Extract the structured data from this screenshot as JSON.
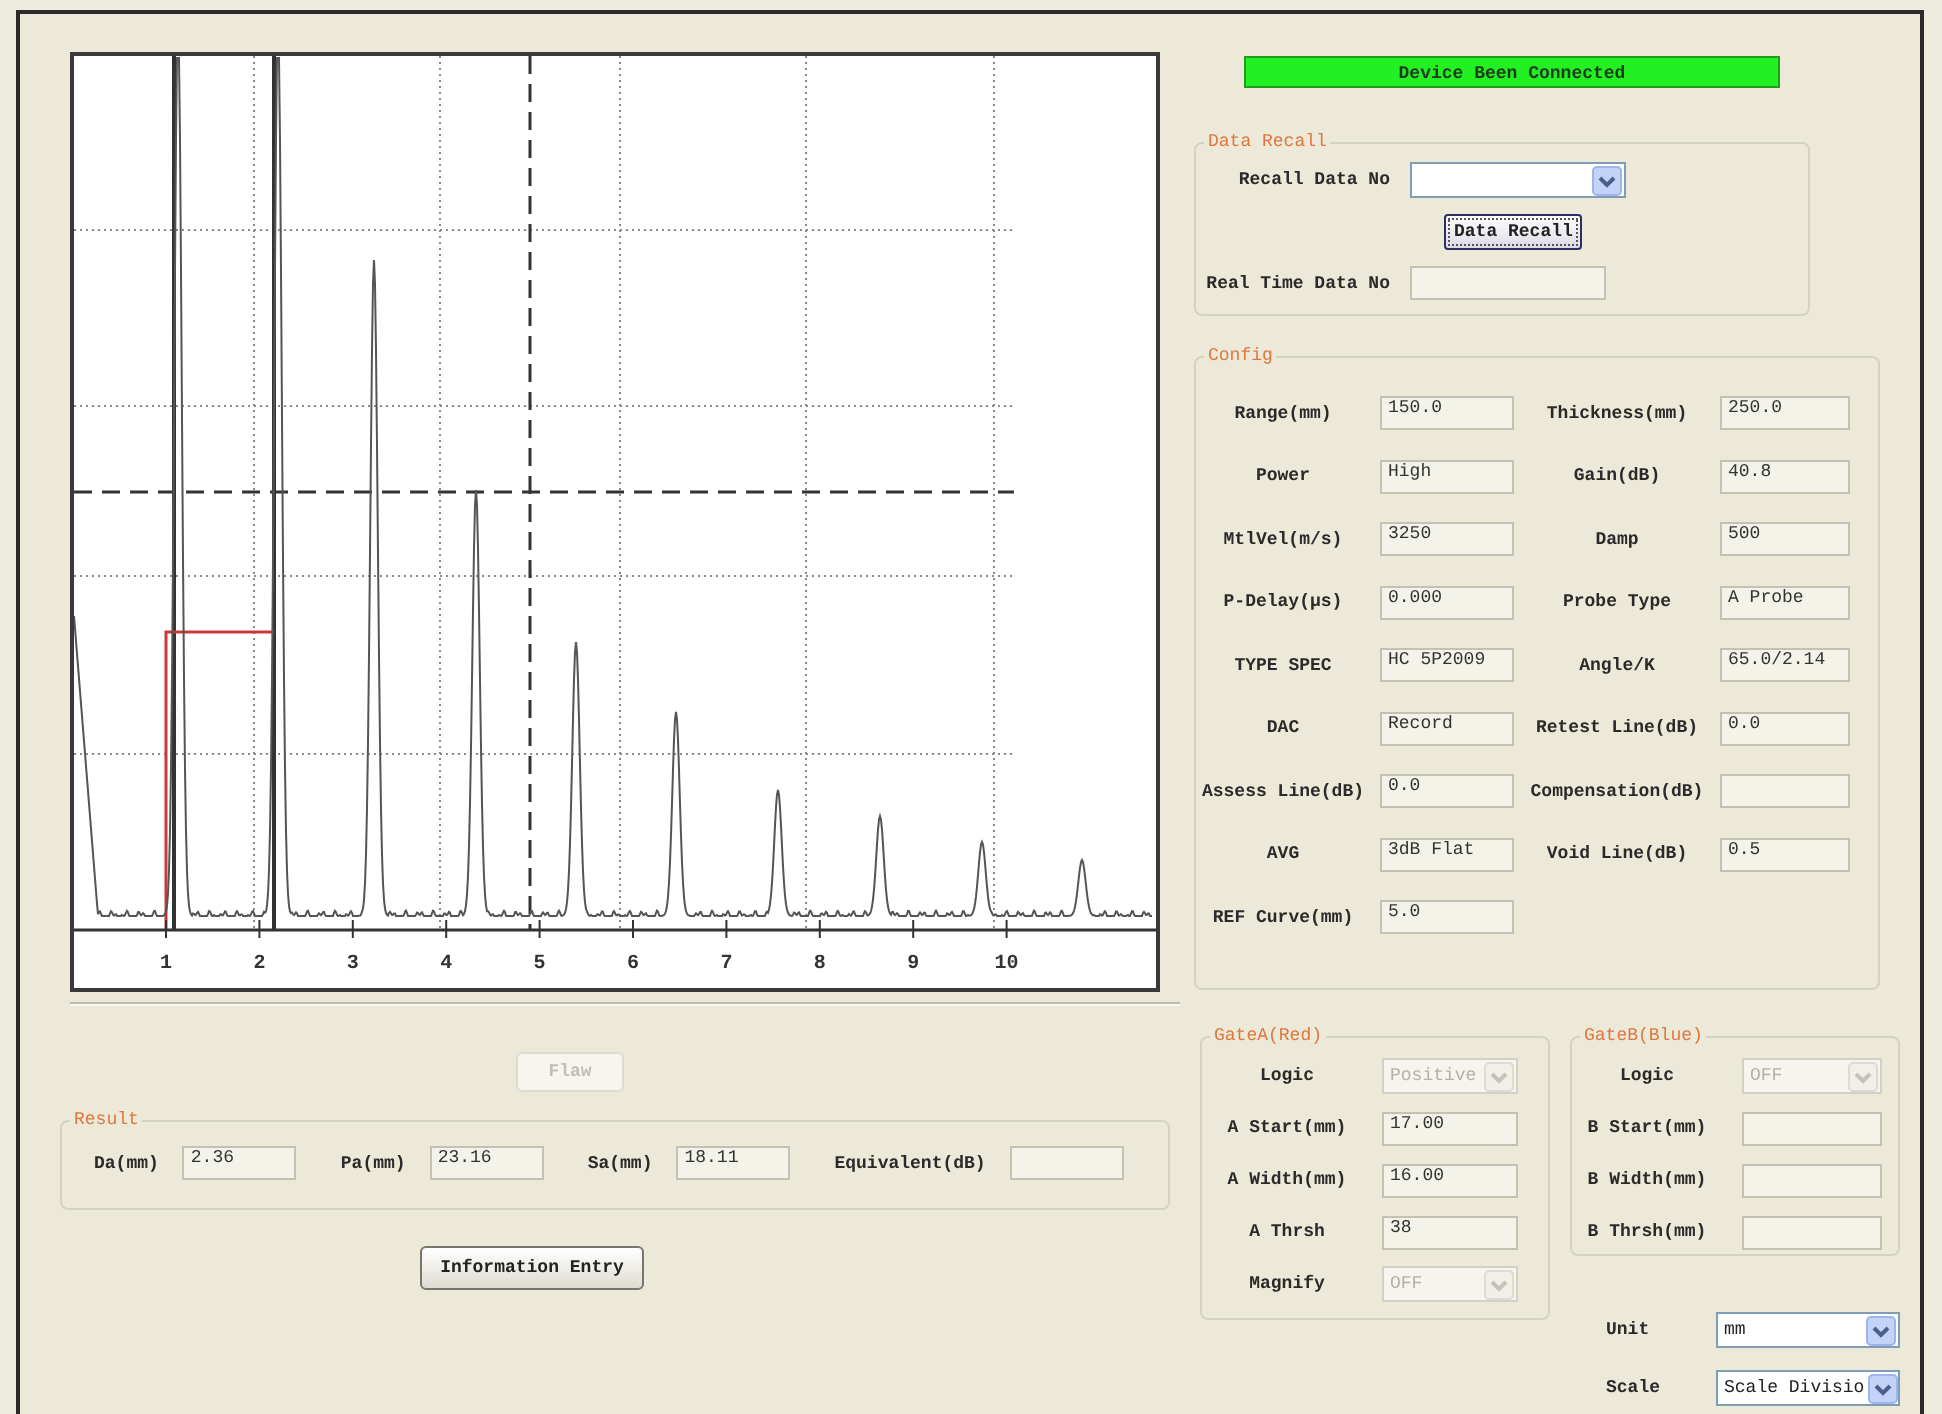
{
  "scope": {
    "scale_labels": [
      "1",
      "2",
      "3",
      "4",
      "5",
      "6",
      "7",
      "8",
      "9",
      "10"
    ]
  },
  "flaw_button": {
    "label": "Flaw",
    "disabled": true
  },
  "result": {
    "title": "Result",
    "fields": [
      {
        "label": "Da(mm)",
        "value": "2.36"
      },
      {
        "label": "Pa(mm)",
        "value": "23.16"
      },
      {
        "label": "Sa(mm)",
        "value": "18.11"
      },
      {
        "label": "Equivalent(dB)"
      }
    ]
  },
  "info_button": {
    "label": "Information Entry"
  },
  "status": {
    "text": "Device Been Connected",
    "connected": true
  },
  "data_recall": {
    "title": "Data Recall",
    "recall_label": "Recall Data No",
    "recall_button": "Data Recall",
    "realtime_label": "Real Time Data No"
  },
  "config": {
    "title": "Config",
    "fields": [
      {
        "label": "Range(mm)",
        "value": "150.0"
      },
      {
        "label": "Thickness(mm)",
        "value": "250.0"
      },
      {
        "label": "Power",
        "value": "High"
      },
      {
        "label": "Gain(dB)",
        "value": "40.8"
      },
      {
        "label": "MtlVel(m/s)",
        "value": "3250"
      },
      {
        "label": "Damp",
        "value": "500"
      },
      {
        "label": "P-Delay(μs)",
        "value": "0.000"
      },
      {
        "label": "Probe Type",
        "value": "A Probe"
      },
      {
        "label": "TYPE SPEC",
        "value": "HC 5P2009"
      },
      {
        "label": "Angle/K",
        "value": "65.0/2.14"
      },
      {
        "label": "DAC",
        "value": "Record"
      },
      {
        "label": "Retest Line(dB)",
        "value": "0.0"
      },
      {
        "label": "Assess Line(dB)",
        "value": "0.0"
      },
      {
        "label": "Compensation(dB)"
      },
      {
        "label": "AVG",
        "value": "3dB Flat"
      },
      {
        "label": "Void Line(dB)",
        "value": "0.5"
      },
      {
        "label": "REF Curve(mm)",
        "value": "5.0"
      }
    ]
  },
  "gate_a": {
    "title": "GateA(Red)",
    "rows": [
      {
        "kind": "select",
        "label": "Logic",
        "value": "Positive",
        "disabled": true
      },
      {
        "kind": "input",
        "label": "A Start(mm)",
        "value": "17.00",
        "disabled": false
      },
      {
        "kind": "input",
        "label": "A Width(mm)",
        "value": "16.00",
        "disabled": false
      },
      {
        "kind": "input",
        "label": "A Thrsh",
        "value": "38",
        "disabled": false
      },
      {
        "kind": "select",
        "label": "Magnify",
        "value": "OFF",
        "disabled": true
      }
    ]
  },
  "gate_b": {
    "title": "GateB(Blue)",
    "rows": [
      {
        "kind": "select",
        "label": "Logic",
        "value": "OFF",
        "disabled": true
      },
      {
        "kind": "input",
        "label": "B Start(mm)",
        "disabled": false
      },
      {
        "kind": "input",
        "label": "B Width(mm)",
        "disabled": false
      },
      {
        "kind": "input",
        "label": "B Thrsh(mm)",
        "disabled": false
      }
    ]
  },
  "unit": {
    "label": "Unit",
    "value": "mm"
  },
  "scale": {
    "label": "Scale",
    "value": "Scale Divisio"
  }
}
